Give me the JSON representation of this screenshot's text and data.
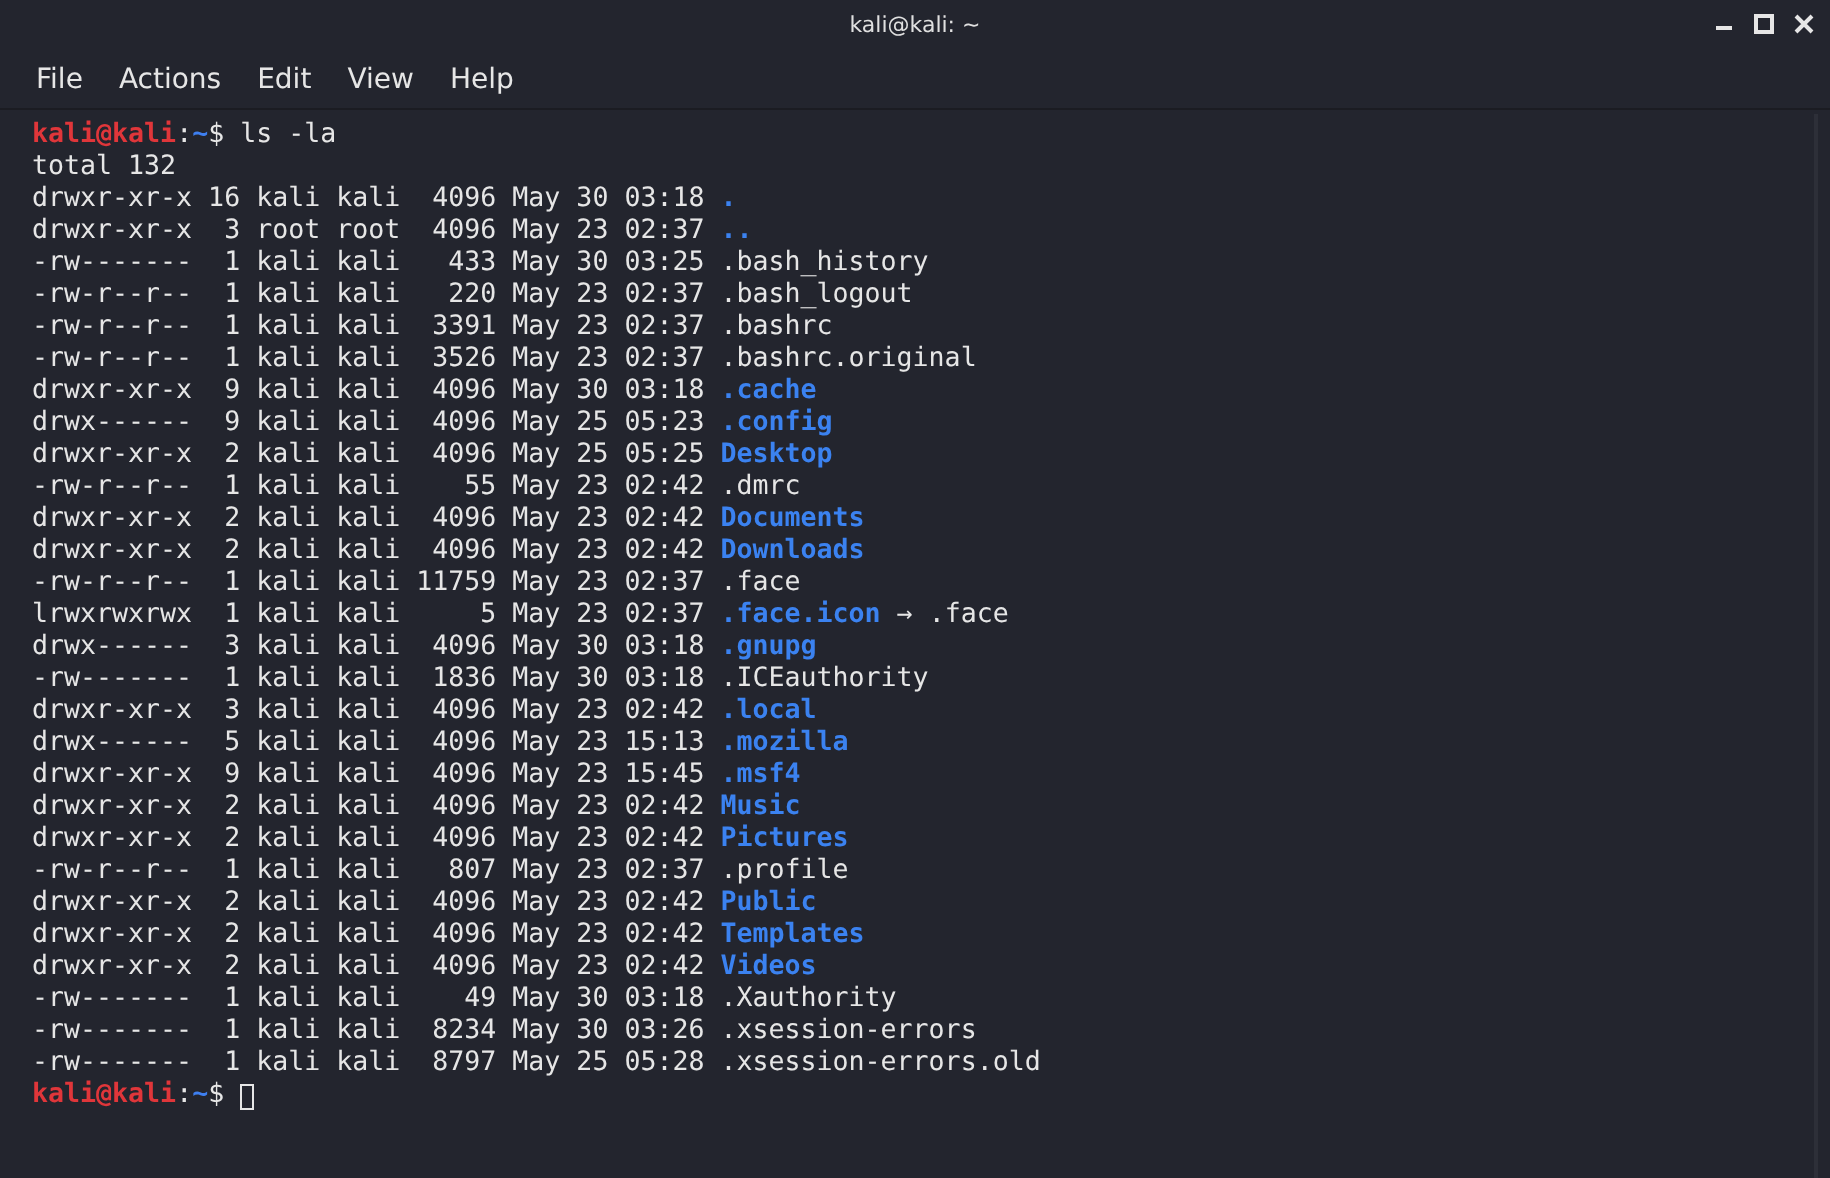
{
  "window": {
    "title": "kali@kali: ~"
  },
  "menu": [
    "File",
    "Actions",
    "Edit",
    "View",
    "Help"
  ],
  "terminal": {
    "command_prompt": {
      "user_host": "kali@kali",
      "separator": ":",
      "path": "~",
      "symbol": "$",
      "command": "ls -la"
    },
    "total": "total 132",
    "entries": [
      {
        "info": "drwxr-xr-x 16 kali kali  4096 May 30 03:18",
        "name": ".",
        "kind": "dir"
      },
      {
        "info": "drwxr-xr-x  3 root root  4096 May 23 02:37",
        "name": "..",
        "kind": "dir"
      },
      {
        "info": "-rw-------  1 kali kali   433 May 30 03:25",
        "name": ".bash_history",
        "kind": "file"
      },
      {
        "info": "-rw-r--r--  1 kali kali   220 May 23 02:37",
        "name": ".bash_logout",
        "kind": "file"
      },
      {
        "info": "-rw-r--r--  1 kali kali  3391 May 23 02:37",
        "name": ".bashrc",
        "kind": "file"
      },
      {
        "info": "-rw-r--r--  1 kali kali  3526 May 23 02:37",
        "name": ".bashrc.original",
        "kind": "file"
      },
      {
        "info": "drwxr-xr-x  9 kali kali  4096 May 30 03:18",
        "name": ".cache",
        "kind": "dir"
      },
      {
        "info": "drwx------  9 kali kali  4096 May 25 05:23",
        "name": ".config",
        "kind": "dir"
      },
      {
        "info": "drwxr-xr-x  2 kali kali  4096 May 25 05:25",
        "name": "Desktop",
        "kind": "dir"
      },
      {
        "info": "-rw-r--r--  1 kali kali    55 May 23 02:42",
        "name": ".dmrc",
        "kind": "file"
      },
      {
        "info": "drwxr-xr-x  2 kali kali  4096 May 23 02:42",
        "name": "Documents",
        "kind": "dir"
      },
      {
        "info": "drwxr-xr-x  2 kali kali  4096 May 23 02:42",
        "name": "Downloads",
        "kind": "dir"
      },
      {
        "info": "-rw-r--r--  1 kali kali 11759 May 23 02:37",
        "name": ".face",
        "kind": "file"
      },
      {
        "info": "lrwxrwxrwx  1 kali kali     5 May 23 02:37",
        "name": ".face.icon",
        "kind": "link",
        "arrow": "→",
        "target": ".face"
      },
      {
        "info": "drwx------  3 kali kali  4096 May 30 03:18",
        "name": ".gnupg",
        "kind": "dir"
      },
      {
        "info": "-rw-------  1 kali kali  1836 May 30 03:18",
        "name": ".ICEauthority",
        "kind": "file"
      },
      {
        "info": "drwxr-xr-x  3 kali kali  4096 May 23 02:42",
        "name": ".local",
        "kind": "dir"
      },
      {
        "info": "drwx------  5 kali kali  4096 May 23 15:13",
        "name": ".mozilla",
        "kind": "dir"
      },
      {
        "info": "drwxr-xr-x  9 kali kali  4096 May 23 15:45",
        "name": ".msf4",
        "kind": "dir"
      },
      {
        "info": "drwxr-xr-x  2 kali kali  4096 May 23 02:42",
        "name": "Music",
        "kind": "dir"
      },
      {
        "info": "drwxr-xr-x  2 kali kali  4096 May 23 02:42",
        "name": "Pictures",
        "kind": "dir"
      },
      {
        "info": "-rw-r--r--  1 kali kali   807 May 23 02:37",
        "name": ".profile",
        "kind": "file"
      },
      {
        "info": "drwxr-xr-x  2 kali kali  4096 May 23 02:42",
        "name": "Public",
        "kind": "dir"
      },
      {
        "info": "drwxr-xr-x  2 kali kali  4096 May 23 02:42",
        "name": "Templates",
        "kind": "dir"
      },
      {
        "info": "drwxr-xr-x  2 kali kali  4096 May 23 02:42",
        "name": "Videos",
        "kind": "dir"
      },
      {
        "info": "-rw-------  1 kali kali    49 May 30 03:18",
        "name": ".Xauthority",
        "kind": "file"
      },
      {
        "info": "-rw-------  1 kali kali  8234 May 30 03:26",
        "name": ".xsession-errors",
        "kind": "file"
      },
      {
        "info": "-rw-------  1 kali kali  8797 May 25 05:28",
        "name": ".xsession-errors.old",
        "kind": "file"
      }
    ],
    "input_prompt": {
      "user_host": "kali@kali",
      "separator": ":",
      "path": "~",
      "symbol": "$"
    }
  }
}
